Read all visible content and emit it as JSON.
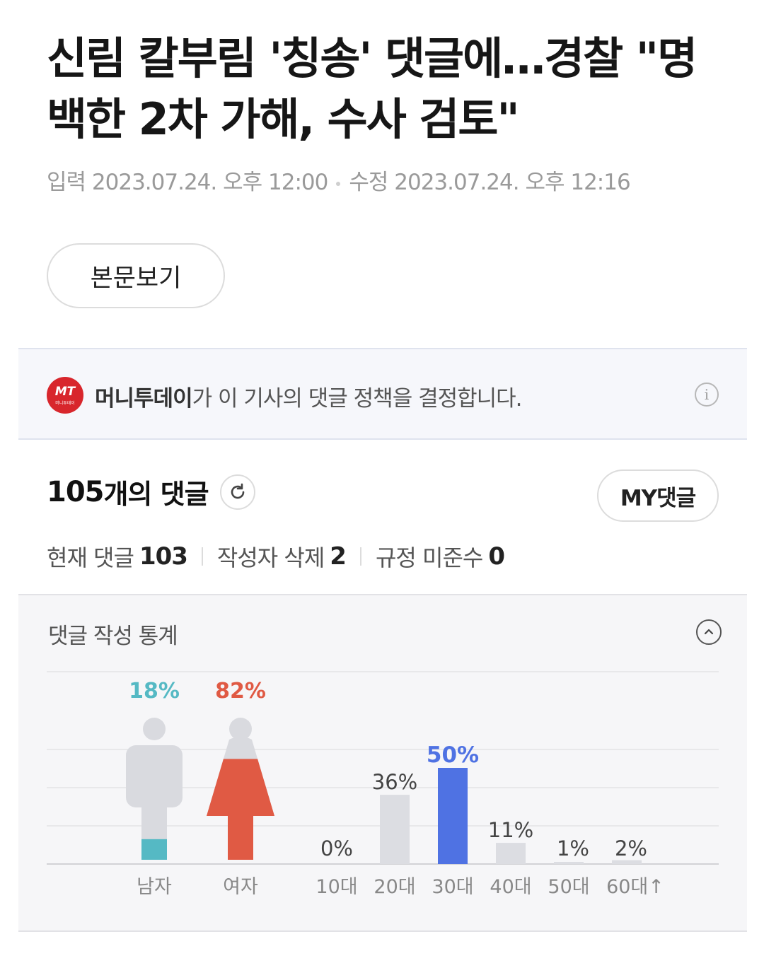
{
  "article": {
    "title": "신림 칼부림 '칭송' 댓글에…경찰 \"명백한 2차 가해, 수사 검토\"",
    "input_label": "입력",
    "input_date": "2023.07.24. 오후 12:00",
    "modified_label": "수정",
    "modified_date": "2023.07.24. 오후 12:16",
    "view_body_button": "본문보기"
  },
  "policy": {
    "logo_text": "MT",
    "logo_sub": "머니투데이",
    "publisher": "머니투데이",
    "text": "가 이 기사의 댓글 정책을 결정합니다."
  },
  "comments": {
    "count": "105",
    "count_label": "개의 댓글",
    "my_comments_button": "MY댓글",
    "current_label": "현재 댓글",
    "current_value": "103",
    "author_deleted_label": "작성자 삭제",
    "author_deleted_value": "2",
    "violation_label": "규정 미준수",
    "violation_value": "0"
  },
  "stats": {
    "title": "댓글 작성 통계"
  },
  "colors": {
    "male": "#55b9c4",
    "female": "#e05a44",
    "highlight_age": "#4f72e3",
    "neutral_bar": "#dcdde2"
  },
  "chart_data": [
    {
      "type": "bar",
      "title": "",
      "categories": [
        "남자",
        "여자"
      ],
      "values": [
        18,
        82
      ],
      "value_labels": [
        "18%",
        "82%"
      ]
    },
    {
      "type": "bar",
      "title": "",
      "categories": [
        "10대",
        "20대",
        "30대",
        "40대",
        "50대",
        "60대↑"
      ],
      "values": [
        0,
        36,
        50,
        11,
        1,
        2
      ],
      "value_labels": [
        "0%",
        "36%",
        "50%",
        "11%",
        "1%",
        "2%"
      ],
      "highlight": "30대"
    }
  ]
}
